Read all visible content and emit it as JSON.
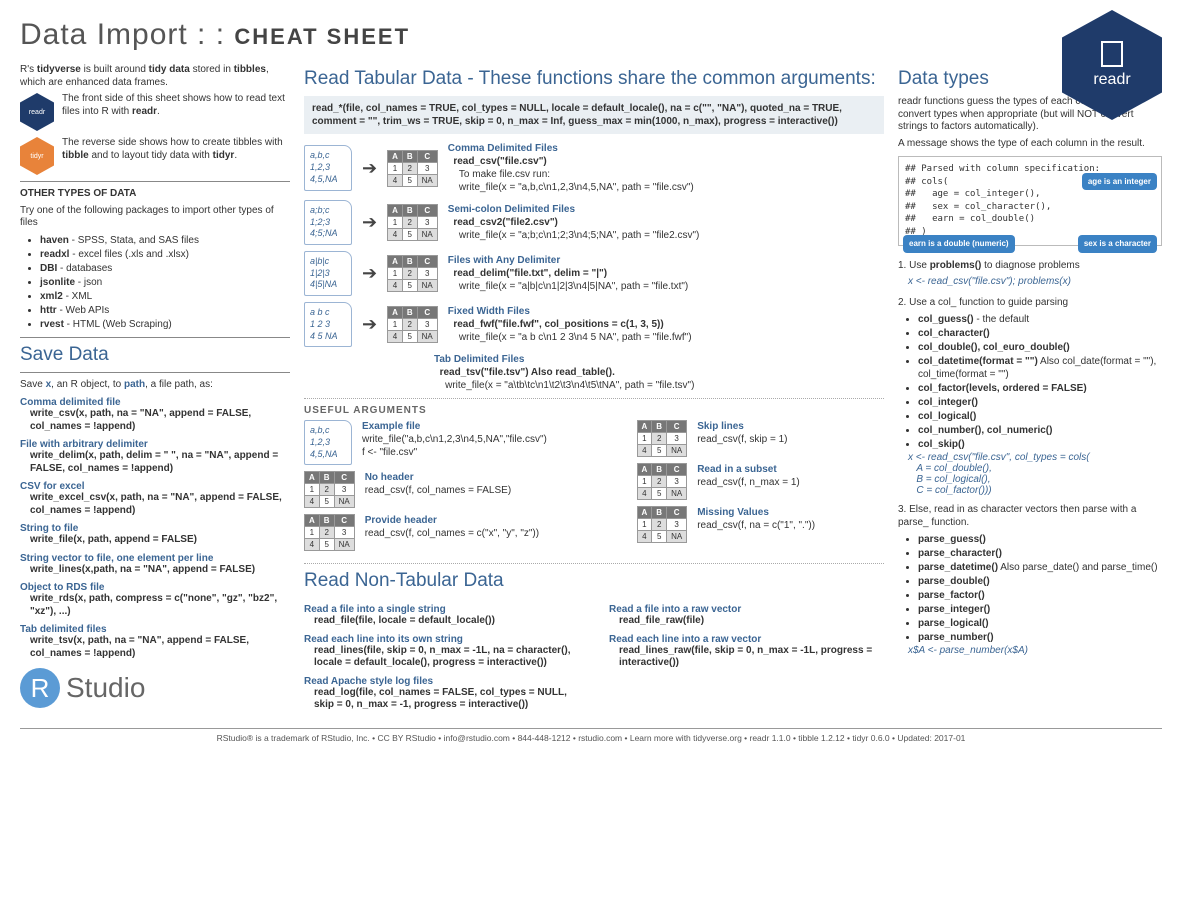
{
  "title_main": "Data Import : : ",
  "title_caps": "CHEAT SHEET",
  "hex_label": "readr",
  "intro": {
    "p1a": "R's ",
    "p1b": "tidyverse",
    "p1c": " is built around ",
    "p1d": "tidy data",
    "p1e": " stored in ",
    "p1f": "tibbles",
    "p1g": ", which are enhanced data frames.",
    "row1_icon": "readr",
    "row1": "The front side of this sheet shows how to read text files into R with ",
    "row1b": "readr",
    "row1c": ".",
    "row2_icon": "tidyr",
    "row2": "The reverse side shows how to create tibbles with ",
    "row2b": "tibble",
    "row2c": " and to layout tidy data with ",
    "row2d": "tidyr",
    "row2e": "."
  },
  "other_types_head": "OTHER TYPES OF DATA",
  "other_types_intro": "Try one of the following packages to import other types of files",
  "other_types": [
    {
      "b": "haven",
      "t": " - SPSS, Stata, and SAS files"
    },
    {
      "b": "readxl",
      "t": " - excel files (.xls and .xlsx)"
    },
    {
      "b": "DBI",
      "t": " - databases"
    },
    {
      "b": "jsonlite",
      "t": " - json"
    },
    {
      "b": "xml2",
      "t": " - XML"
    },
    {
      "b": "httr",
      "t": " - Web APIs"
    },
    {
      "b": "rvest",
      "t": " - HTML (Web Scraping)"
    }
  ],
  "save_head": "Save Data",
  "save_intro_a": "Save ",
  "save_intro_b": "x",
  "save_intro_c": ", an R object, to ",
  "save_intro_d": "path",
  "save_intro_e": ", a file path, as:",
  "save": [
    {
      "t": "Comma delimited file",
      "c": "write_csv(x, path, na = \"NA\", append = FALSE, col_names = !append)"
    },
    {
      "t": "File with arbitrary delimiter",
      "c": "write_delim(x, path, delim = \" \", na = \"NA\", append = FALSE, col_names = !append)"
    },
    {
      "t": "CSV for excel",
      "c": "write_excel_csv(x, path, na = \"NA\", append = FALSE, col_names = !append)"
    },
    {
      "t": "String to file",
      "c": "write_file(x, path, append = FALSE)"
    },
    {
      "t": "String vector to file, one element per line",
      "c": "write_lines(x,path, na = \"NA\", append = FALSE)"
    },
    {
      "t": "Object to RDS file",
      "c": "write_rds(x, path, compress = c(\"none\", \"gz\", \"bz2\", \"xz\"), ...)"
    },
    {
      "t": "Tab delimited files",
      "c": "write_tsv(x, path, na = \"NA\", append = FALSE, col_names = !append)"
    }
  ],
  "read_head": "Read Tabular Data",
  "read_sub": " - These functions share the common arguments:",
  "read_sig": "read_*(file, col_names = TRUE, col_types = NULL, locale = default_locale(), na = c(\"\", \"NA\"), quoted_na = TRUE, comment = \"\", trim_ws = TRUE, skip = 0, n_max = Inf, guess_max = min(1000, n_max), progress = interactive())",
  "tab_rows": [
    {
      "file": "a,b,c\n1,2,3\n4,5,NA",
      "t": "Comma Delimited Files",
      "c": "read_csv(\"file.csv\")",
      "sub": "To make file.csv run:",
      "w": "write_file(x = \"a,b,c\\n1,2,3\\n4,5,NA\", path = \"file.csv\")"
    },
    {
      "file": "a;b;c\n1;2;3\n4;5;NA",
      "t": "Semi-colon Delimited Files",
      "c": "read_csv2(\"file2.csv\")",
      "sub": "",
      "w": "write_file(x = \"a;b;c\\n1;2;3\\n4;5;NA\", path = \"file2.csv\")"
    },
    {
      "file": "a|b|c\n1|2|3\n4|5|NA",
      "t": "Files with Any Delimiter",
      "c": "read_delim(\"file.txt\", delim = \"|\")",
      "sub": "",
      "w": "write_file(x = \"a|b|c\\n1|2|3\\n4|5|NA\", path = \"file.txt\")"
    },
    {
      "file": "a b c\n1 2 3\n4 5 NA",
      "t": "Fixed Width Files",
      "c": "read_fwf(\"file.fwf\", col_positions = c(1, 3, 5))",
      "sub": "",
      "w": "write_file(x = \"a b c\\n1 2 3\\n4 5 NA\", path = \"file.fwf\")"
    }
  ],
  "tab_extra_t": "Tab Delimited Files",
  "tab_extra_c": "read_tsv(\"file.tsv\") Also read_table().",
  "tab_extra_w": "write_file(x = \"a\\tb\\tc\\n1\\t2\\t3\\n4\\t5\\tNA\", path = \"file.tsv\")",
  "useful_head": "USEFUL ARGUMENTS",
  "useful_left": [
    {
      "t": "Example file",
      "c": "write_file(\"a,b,c\\n1,2,3\\n4,5,NA\",\"file.csv\")\nf <- \"file.csv\"",
      "file": true
    },
    {
      "t": "No header",
      "c": "read_csv(f, col_names = FALSE)"
    },
    {
      "t": "Provide header",
      "c": "read_csv(f, col_names = c(\"x\", \"y\", \"z\"))"
    }
  ],
  "useful_right": [
    {
      "t": "Skip lines",
      "c": "read_csv(f, skip = 1)"
    },
    {
      "t": "Read in a subset",
      "c": "read_csv(f, n_max = 1)"
    },
    {
      "t": "Missing Values",
      "c": "read_csv(f, na = c(\"1\", \".\"))"
    }
  ],
  "nontab_head": "Read Non-Tabular Data",
  "nontab_left": [
    {
      "t": "Read a file into a single string",
      "c": "read_file(file, locale = default_locale())"
    },
    {
      "t": "Read each line into its own string",
      "c": "read_lines(file, skip = 0, n_max = -1L, na = character(), locale = default_locale(), progress = interactive())"
    },
    {
      "t": "Read Apache style log files",
      "c": "read_log(file, col_names = FALSE, col_types = NULL, skip = 0, n_max = -1, progress = interactive())"
    }
  ],
  "nontab_right": [
    {
      "t": "Read a file into a raw vector",
      "c": "read_file_raw(file)"
    },
    {
      "t": "Read each line into a raw vector",
      "c": "read_lines_raw(file, skip = 0, n_max = -1L, progress = interactive())"
    }
  ],
  "dtypes_head": "Data types",
  "dtypes_p1": "readr functions guess the types of each column and convert types when appropriate (but will NOT convert strings to factors automatically).",
  "dtypes_p2": "A message shows the type of each column in the result.",
  "parsebox": "## Parsed with column specification:\n## cols(\n##   age = col_integer(),\n##   sex = col_character(),\n##   earn = col_double()\n## )",
  "bubbles": {
    "a": "age is an integer",
    "b": "earn is a double (numeric)",
    "c": "sex is a character"
  },
  "step1a": "1. Use ",
  "step1b": "problems()",
  "step1c": " to diagnose problems",
  "step1code": "x <- read_csv(\"file.csv\"); problems(x)",
  "step2": "2. Use a col_ function to guide parsing",
  "col_funcs": [
    {
      "b": "col_guess()",
      "t": " - the default"
    },
    {
      "b": "col_character()",
      "t": ""
    },
    {
      "b": "col_double(), col_euro_double()",
      "t": ""
    },
    {
      "b": "col_datetime(format = \"\")",
      "t": " Also col_date(format = \"\"), col_time(format = \"\")"
    },
    {
      "b": "col_factor(levels, ordered = FALSE)",
      "t": ""
    },
    {
      "b": "col_integer()",
      "t": ""
    },
    {
      "b": "col_logical()",
      "t": ""
    },
    {
      "b": "col_number(), col_numeric()",
      "t": ""
    },
    {
      "b": "col_skip()",
      "t": ""
    }
  ],
  "step2code": "x <- read_csv(\"file.csv\", col_types = cols(\n   A = col_double(),\n   B = col_logical(),\n   C = col_factor()))",
  "step3": "3. Else, read in as character vectors then parse with a parse_ function.",
  "parse_funcs": [
    {
      "b": "parse_guess()"
    },
    {
      "b": "parse_character()"
    },
    {
      "b": "parse_datetime()",
      "t": " Also parse_date() and parse_time()"
    },
    {
      "b": "parse_double()"
    },
    {
      "b": "parse_factor()"
    },
    {
      "b": "parse_integer()"
    },
    {
      "b": "parse_logical()"
    },
    {
      "b": "parse_number()"
    }
  ],
  "step3code": "x$A <- parse_number(x$A)",
  "footer": "RStudio® is a trademark of RStudio, Inc.  •  CC BY RStudio  •  info@rstudio.com  •  844-448-1212  •  rstudio.com  •  Learn more with tidyverse.org  •  readr 1.1.0  •  tibble 1.2.12  •  tidyr 0.6.0  •  Updated: 2017-01",
  "logo_text": "Studio"
}
